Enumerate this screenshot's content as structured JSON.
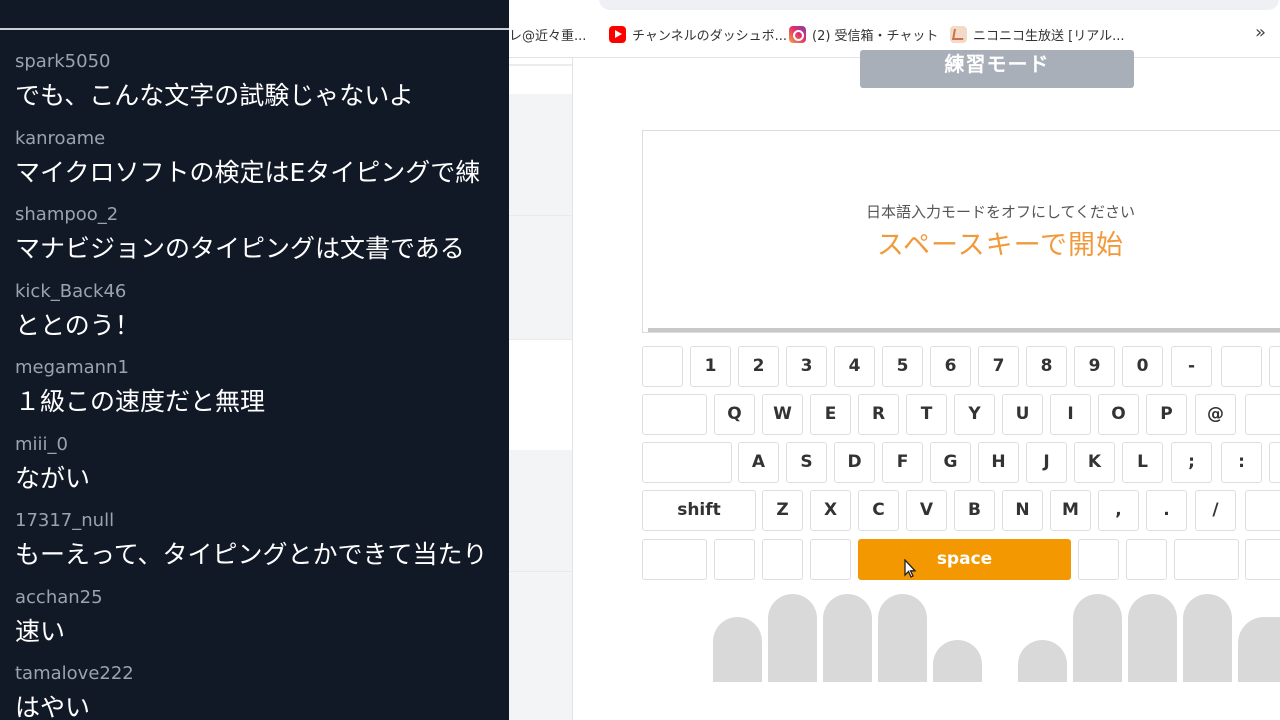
{
  "chat": {
    "messages": [
      {
        "user": "spark5050",
        "text": "でも、こんな文字の試験じゃないよ"
      },
      {
        "user": "kanroame",
        "text": "マイクロソフトの検定はEタイピングで練"
      },
      {
        "user": "shampoo_2",
        "text": "マナビジョンのタイピングは文書である"
      },
      {
        "user": "kick_Back46",
        "text": "ととのう！"
      },
      {
        "user": "megamann1",
        "text": "１級この速度だと無理"
      },
      {
        "user": "miii_0",
        "text": "ながい"
      },
      {
        "user": "17317_null",
        "text": "もーえって、タイピングとかできて当たり"
      },
      {
        "user": "acchan25",
        "text": "速い"
      },
      {
        "user": "tamalove222",
        "text": "はやい"
      }
    ]
  },
  "bookmarks": {
    "item1": "レ@近々重...",
    "item2": "チャンネルのダッシュボ...",
    "item3": "(2) 受信箱・チャット",
    "item4": "ニコニコ生放送 [リアル...",
    "more": "»"
  },
  "typing": {
    "mode_button": "練習モード",
    "hint": "日本語入力モードをオフにしてください",
    "start": "スペースキーで開始"
  },
  "keyboard": {
    "row1": [
      "1",
      "2",
      "3",
      "4",
      "5",
      "6",
      "7",
      "8",
      "9",
      "0",
      "-"
    ],
    "row2": [
      "Q",
      "W",
      "E",
      "R",
      "T",
      "Y",
      "U",
      "I",
      "O",
      "P",
      "@"
    ],
    "row3": [
      "A",
      "S",
      "D",
      "F",
      "G",
      "H",
      "J",
      "K",
      "L",
      ";",
      ":"
    ],
    "row4": [
      "Z",
      "X",
      "C",
      "V",
      "B",
      "N",
      "M",
      ",",
      ".",
      "/"
    ],
    "shift": "shift",
    "space": "space"
  },
  "colors": {
    "accent": "#f39800",
    "start_text": "#f19a3b",
    "chat_bg": "#111826"
  }
}
